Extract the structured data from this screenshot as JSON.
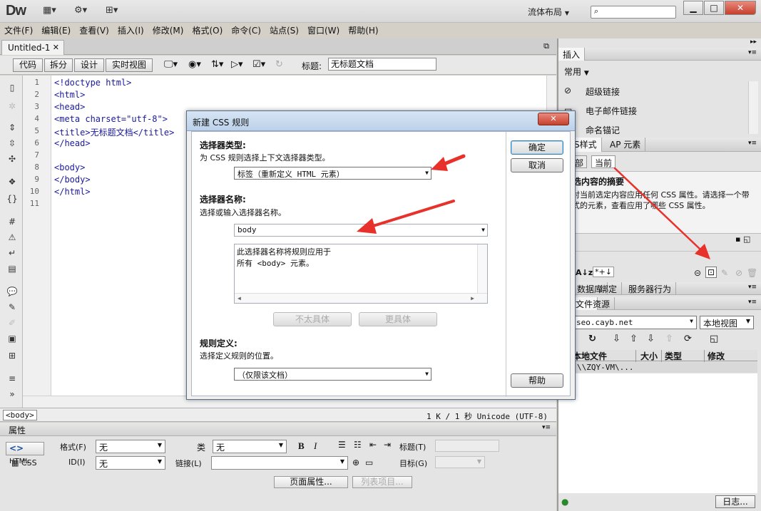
{
  "app": {
    "logo": "Dw",
    "layout": "流体布局",
    "layout_arrow": "▼"
  },
  "menu": [
    "文件(F)",
    "编辑(E)",
    "查看(V)",
    "插入(I)",
    "修改(M)",
    "格式(O)",
    "命令(C)",
    "站点(S)",
    "窗口(W)",
    "帮助(H)"
  ],
  "document": {
    "tab": "Untitled-1",
    "views": [
      "代码",
      "拆分",
      "设计",
      "实时视图"
    ],
    "title_label": "标题:",
    "title_value": "无标题文档",
    "line_numbers": [
      "1",
      "2",
      "3",
      "4",
      "5",
      "6",
      "7",
      "8",
      "9",
      "10",
      "11"
    ],
    "code_lines": [
      "<!doctype html>",
      "<html>",
      "<head>",
      "<meta charset=\"utf-8\">",
      "<title>无标题文档</title>",
      "</head>",
      "",
      "<body>",
      "</body>",
      "</html>",
      ""
    ]
  },
  "status": {
    "tag": "<body>",
    "info": "1 K / 1 秒 Unicode (UTF-8)"
  },
  "properties": {
    "title": "属性",
    "html_btn": "HTML",
    "css_btn": "CSS",
    "format_label": "格式(F)",
    "format_value": "无",
    "class_label": "类",
    "class_value": "无",
    "id_label": "ID(I)",
    "id_value": "无",
    "link_label": "链接(L)",
    "heading_label": "标题(T)",
    "target_label": "目标(G)",
    "bold": "B",
    "italic": "I",
    "page_props": "页面属性...",
    "list_item": "列表项目..."
  },
  "insert_panel": {
    "tab": "插入",
    "category": "常用",
    "items": [
      "超级链接",
      "电子邮件链接",
      "命名锚记"
    ]
  },
  "css_panel": {
    "tabs": [
      "CSS样式",
      "AP 元素"
    ],
    "subtabs": [
      "全部",
      "当前"
    ],
    "summary_title": "所选内容的摘要",
    "summary_text": "未对当前选定内容应用任何 CSS 属性。请选择一个带样式的元素，查看应用了哪些 CSS 属性。"
  },
  "files_panel": {
    "tabs_top": [
      "数据库",
      "绑定",
      "服务器行为"
    ],
    "tabs": [
      "文件",
      "资源"
    ],
    "site": "seo.cayb.net",
    "view": "本地视图",
    "columns": [
      "本地文件",
      "大小",
      "类型",
      "修改"
    ],
    "row": "\\\\ZQY-VM\\...",
    "log_btn": "日志..."
  },
  "dialog": {
    "title": "新建 CSS 规则",
    "selector_type_heading": "选择器类型:",
    "selector_type_desc": "为 CSS 规则选择上下文选择器类型。",
    "selector_type_value": "标签（重新定义 HTML 元素）",
    "selector_name_heading": "选择器名称:",
    "selector_name_desc": "选择或输入选择器名称。",
    "selector_name_value": "body",
    "selector_info_line1": "此选择器名称将规则应用于",
    "selector_info_line2": "所有 <body> 元素。",
    "less_specific": "不太具体",
    "more_specific": "更具体",
    "rule_def_heading": "规则定义:",
    "rule_def_desc": "选择定义规则的位置。",
    "rule_def_value": "（仅限该文档）",
    "ok": "确定",
    "cancel": "取消",
    "help": "帮助"
  },
  "colors": {
    "accent_arrow": "#e8312b",
    "code_tag": "#1a1a9e",
    "dialog_title": "#c8dbef"
  }
}
